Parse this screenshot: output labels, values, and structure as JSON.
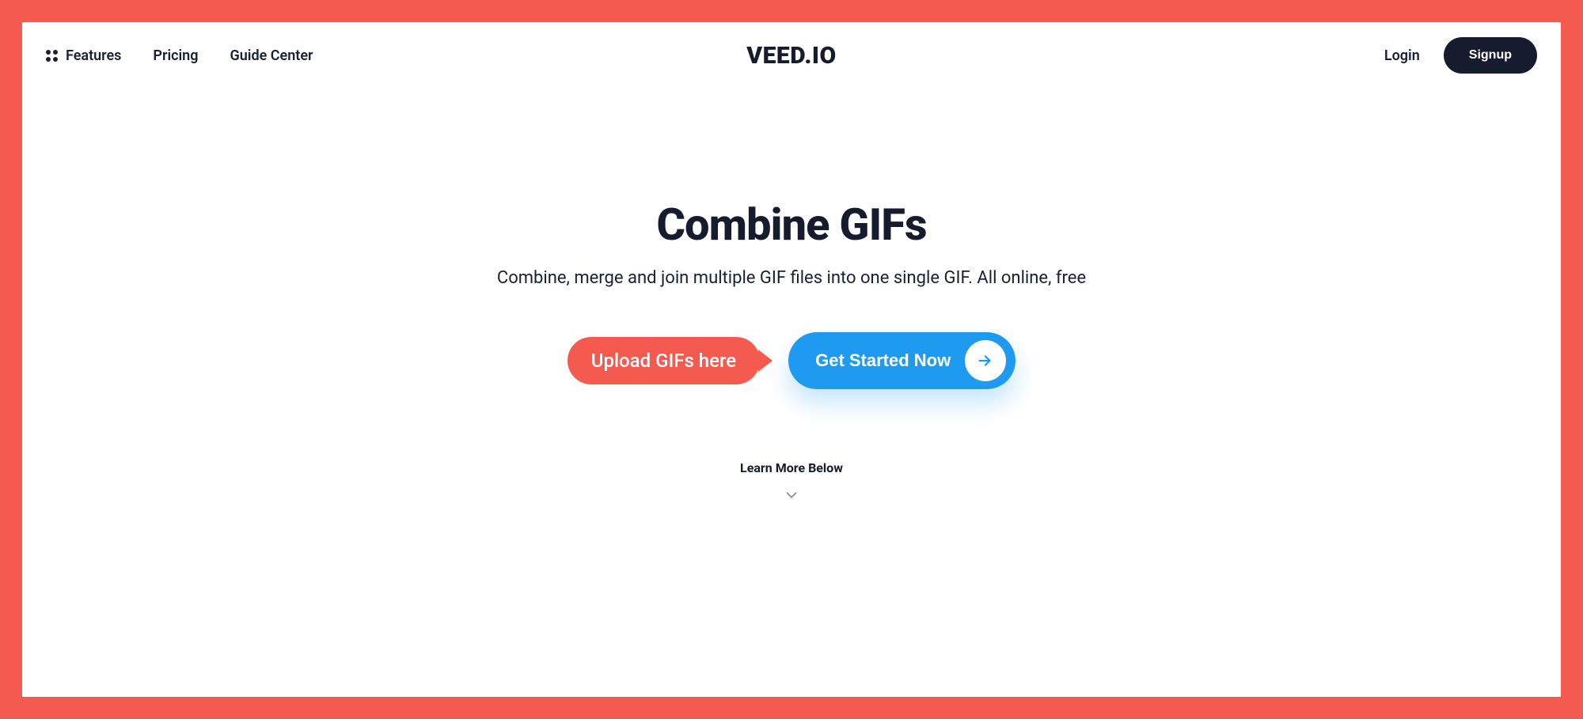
{
  "nav": {
    "features": "Features",
    "pricing": "Pricing",
    "guide": "Guide Center",
    "login": "Login",
    "signup": "Signup"
  },
  "logo": "VEED.IO",
  "hero": {
    "title": "Combine GIFs",
    "subtitle": "Combine, merge and join multiple GIF files into one single GIF. All online, free",
    "tooltip": "Upload GIFs here",
    "cta": "Get Started Now",
    "learn_more": "Learn More Below"
  }
}
